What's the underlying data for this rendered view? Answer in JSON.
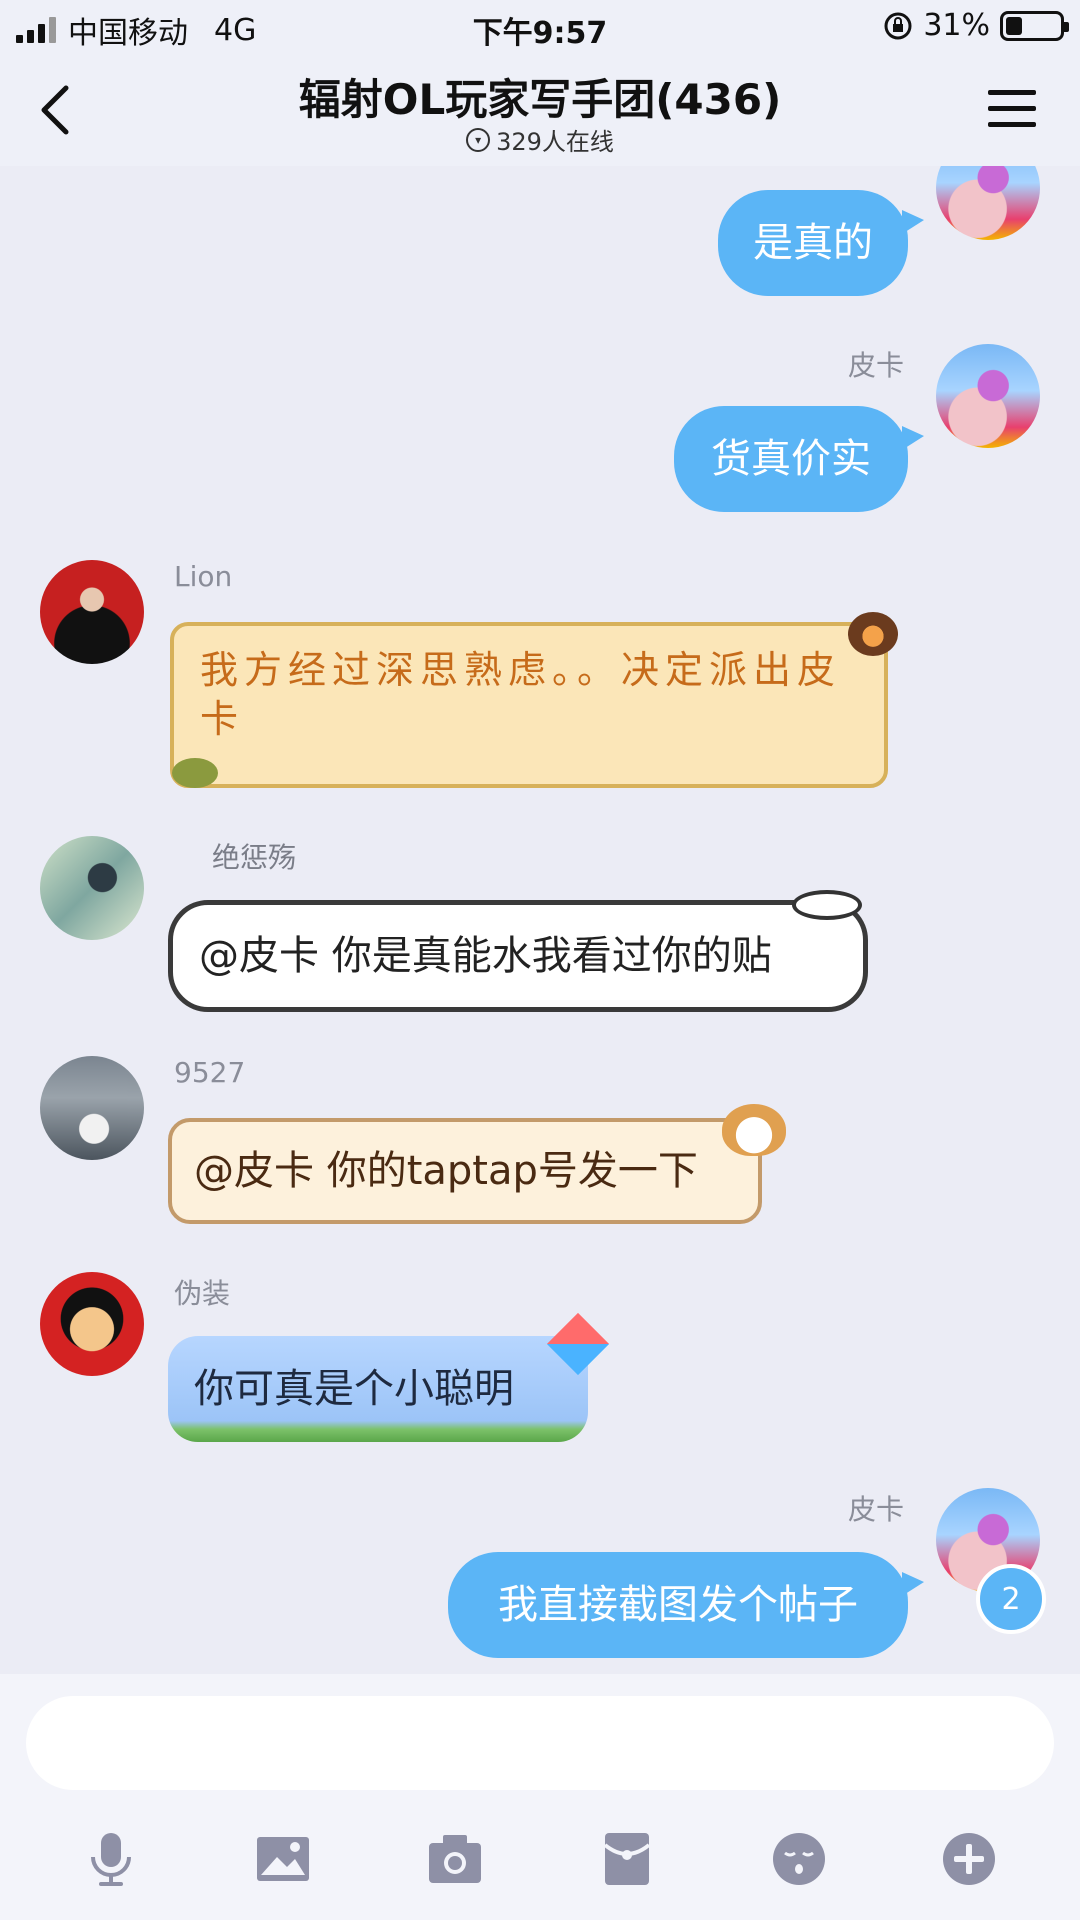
{
  "status_bar": {
    "carrier": "中国移动",
    "network": "4G",
    "time": "下午9:57",
    "battery_percent": "31%",
    "battery_level": 0.31
  },
  "header": {
    "title": "辐射OL玩家写手团(436)",
    "online": "329人在线"
  },
  "messages": [
    {
      "sender": "",
      "text": "是真的",
      "mine": true
    },
    {
      "sender": "皮卡",
      "text": "货真价实",
      "mine": true
    },
    {
      "sender": "Lion",
      "text": "我方经过深思熟虑。。决定派出皮卡",
      "mine": false
    },
    {
      "sender": "绝惩殇",
      "text": "@皮卡  你是真能水我看过你的贴",
      "mine": false
    },
    {
      "sender": "9527",
      "text": "@皮卡 你的taptap号发一下",
      "mine": false
    },
    {
      "sender": "伪装",
      "text": "你可真是个小聪明",
      "mine": false
    },
    {
      "sender": "皮卡",
      "text": "我直接截图发个帖子",
      "mine": true
    }
  ],
  "unread_count": "2",
  "input": {
    "placeholder": ""
  },
  "toolbar": [
    "mic-icon",
    "image-icon",
    "camera-icon",
    "red-packet-icon",
    "emoji-icon",
    "plus-icon"
  ],
  "colors": {
    "my_bubble": "#5bb5f6",
    "background": "#ebecf5",
    "lion_text": "#c66b1a"
  }
}
